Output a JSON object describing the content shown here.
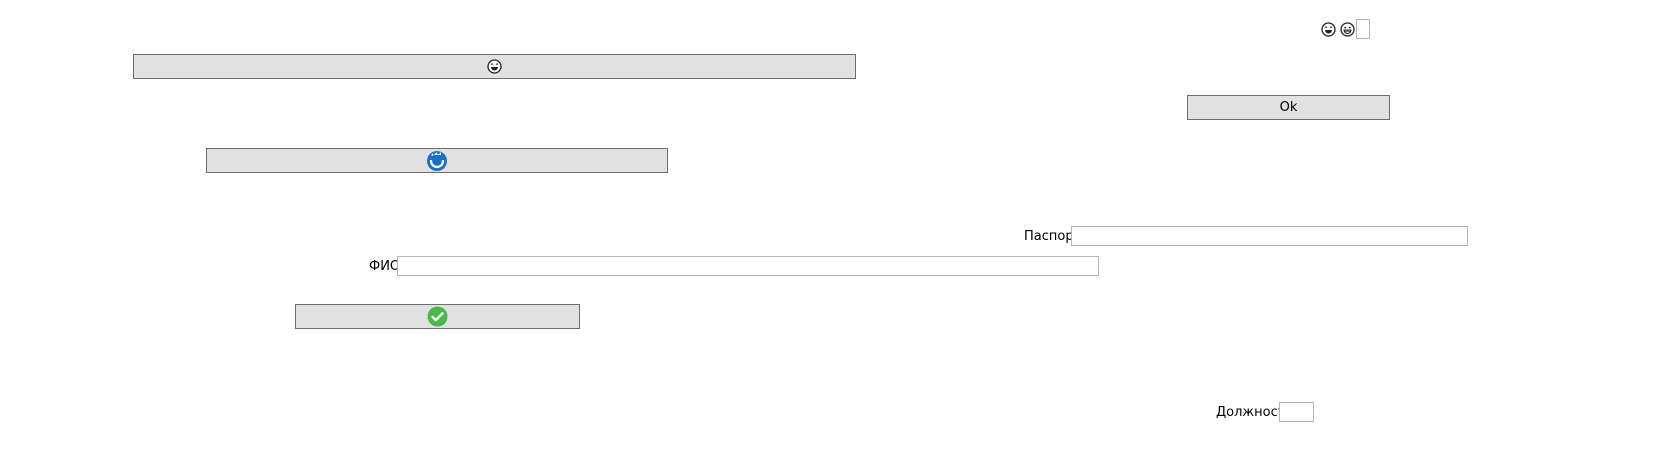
{
  "top_right": {
    "icons": [
      "crying-laughing-face-icon",
      "grinning-face-icon"
    ]
  },
  "buttons": {
    "emoji_button": {
      "icon": "crying-laughing-face-icon"
    },
    "ok_button": {
      "label": "Ok"
    },
    "refresh_button": {
      "icon": "refresh-icon",
      "color": "#1a6fc9"
    },
    "confirm_button": {
      "icon": "green-check-icon",
      "color": "#4cb849"
    }
  },
  "fields": {
    "passport": {
      "label": "Паспорт",
      "value": ""
    },
    "fio": {
      "label": "ФИО",
      "value": ""
    },
    "position": {
      "label": "Должность",
      "value": ""
    }
  }
}
